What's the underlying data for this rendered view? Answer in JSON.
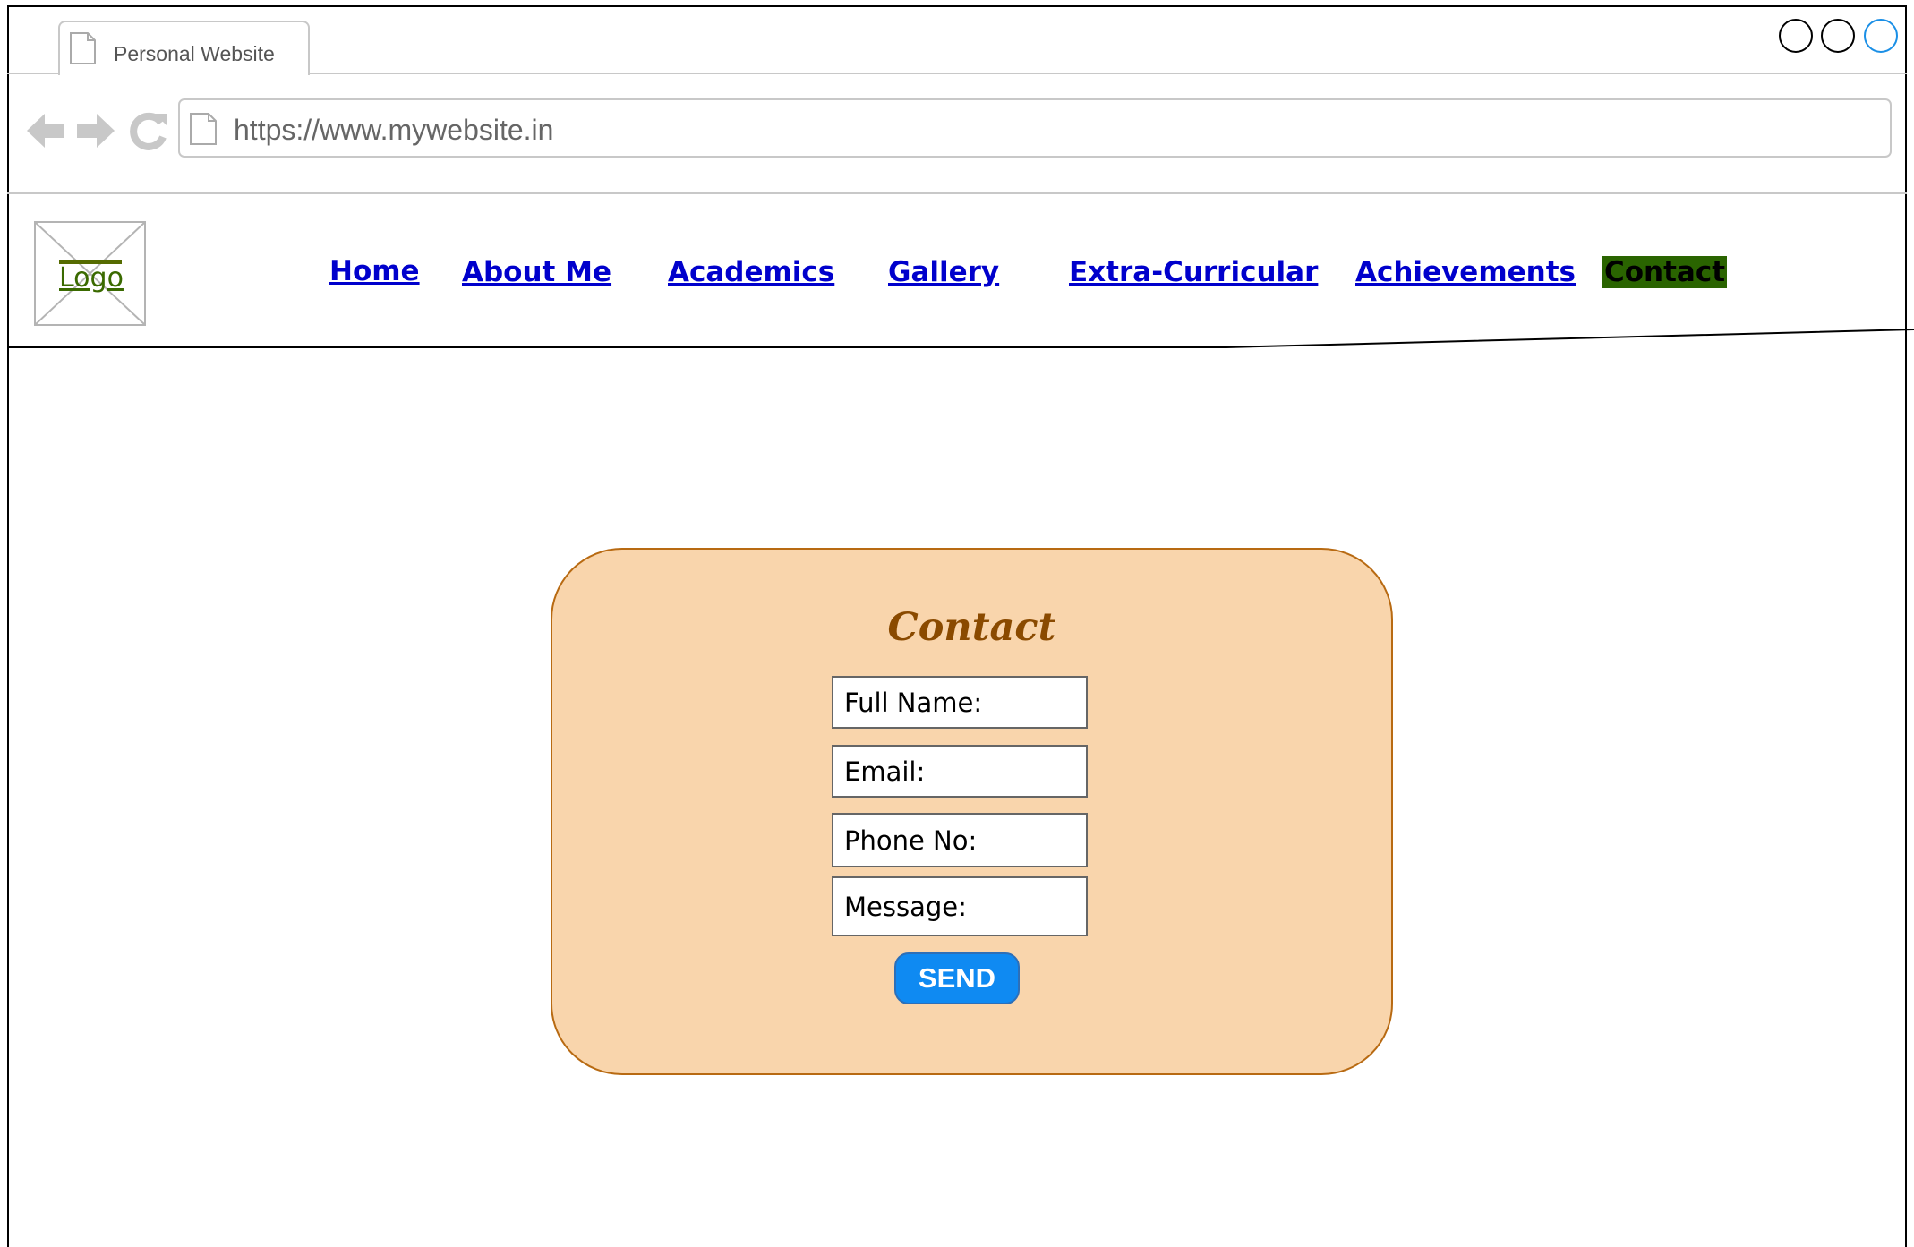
{
  "browser": {
    "tab_title": "Personal Website",
    "url": "https://www.mywebsite.in",
    "icons": [
      "document-icon",
      "back-arrow-icon",
      "forward-arrow-icon",
      "reload-icon"
    ]
  },
  "site": {
    "logo_label": "Logo",
    "nav": {
      "home": "Home",
      "about": "About Me",
      "academics": "Academics",
      "gallery": "Gallery",
      "extra": "Extra-Curricular",
      "achievements": "Achievements",
      "contact": "Contact"
    }
  },
  "contact_form": {
    "title": "Contact",
    "full_name_label": "Full Name:",
    "email_label": "Email:",
    "phone_label": "Phone No:",
    "message_label": "Message:",
    "send_label": "SEND"
  },
  "colors": {
    "card_bg": "#f9d5ac",
    "card_border": "#b86a12",
    "title": "#8a4a00",
    "nav_link": "#0000cc",
    "active_nav_bg": "#2a6400",
    "send_button": "#0f8af2"
  }
}
